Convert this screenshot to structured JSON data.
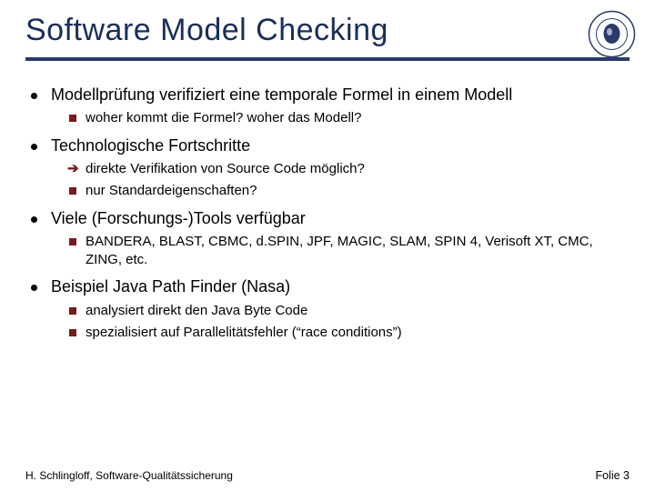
{
  "title": "Software Model Checking",
  "logo_alt": "Humboldt-Universität zu Berlin seal",
  "bullets": [
    {
      "text": "Modellprüfung verifiziert eine temporale Formel in einem Modell",
      "sub": [
        {
          "marker": "sq",
          "text": "woher kommt die Formel? woher das Modell?"
        }
      ]
    },
    {
      "text": "Technologische Fortschritte",
      "sub": [
        {
          "marker": "ar",
          "text": "direkte Verifikation von Source Code möglich?"
        },
        {
          "marker": "sq",
          "text": "nur Standardeigenschaften?"
        }
      ]
    },
    {
      "text": "Viele (Forschungs-)Tools verfügbar",
      "sub": [
        {
          "marker": "sq",
          "text": "BANDERA, BLAST, CBMC, d.SPIN, JPF, MAGIC, SLAM, SPIN 4,  Verisoft XT, CMC, ZING, etc."
        }
      ]
    },
    {
      "text": "Beispiel Java Path Finder (Nasa)",
      "sub": [
        {
          "marker": "sq",
          "text": "analysiert direkt den Java Byte Code"
        },
        {
          "marker": "sq",
          "text": "spezialisiert auf Parallelitätsfehler (“race conditions”)"
        }
      ]
    }
  ],
  "footer": {
    "left": "H. Schlingloff, Software-Qualitätssicherung",
    "right": "Folie 3"
  }
}
